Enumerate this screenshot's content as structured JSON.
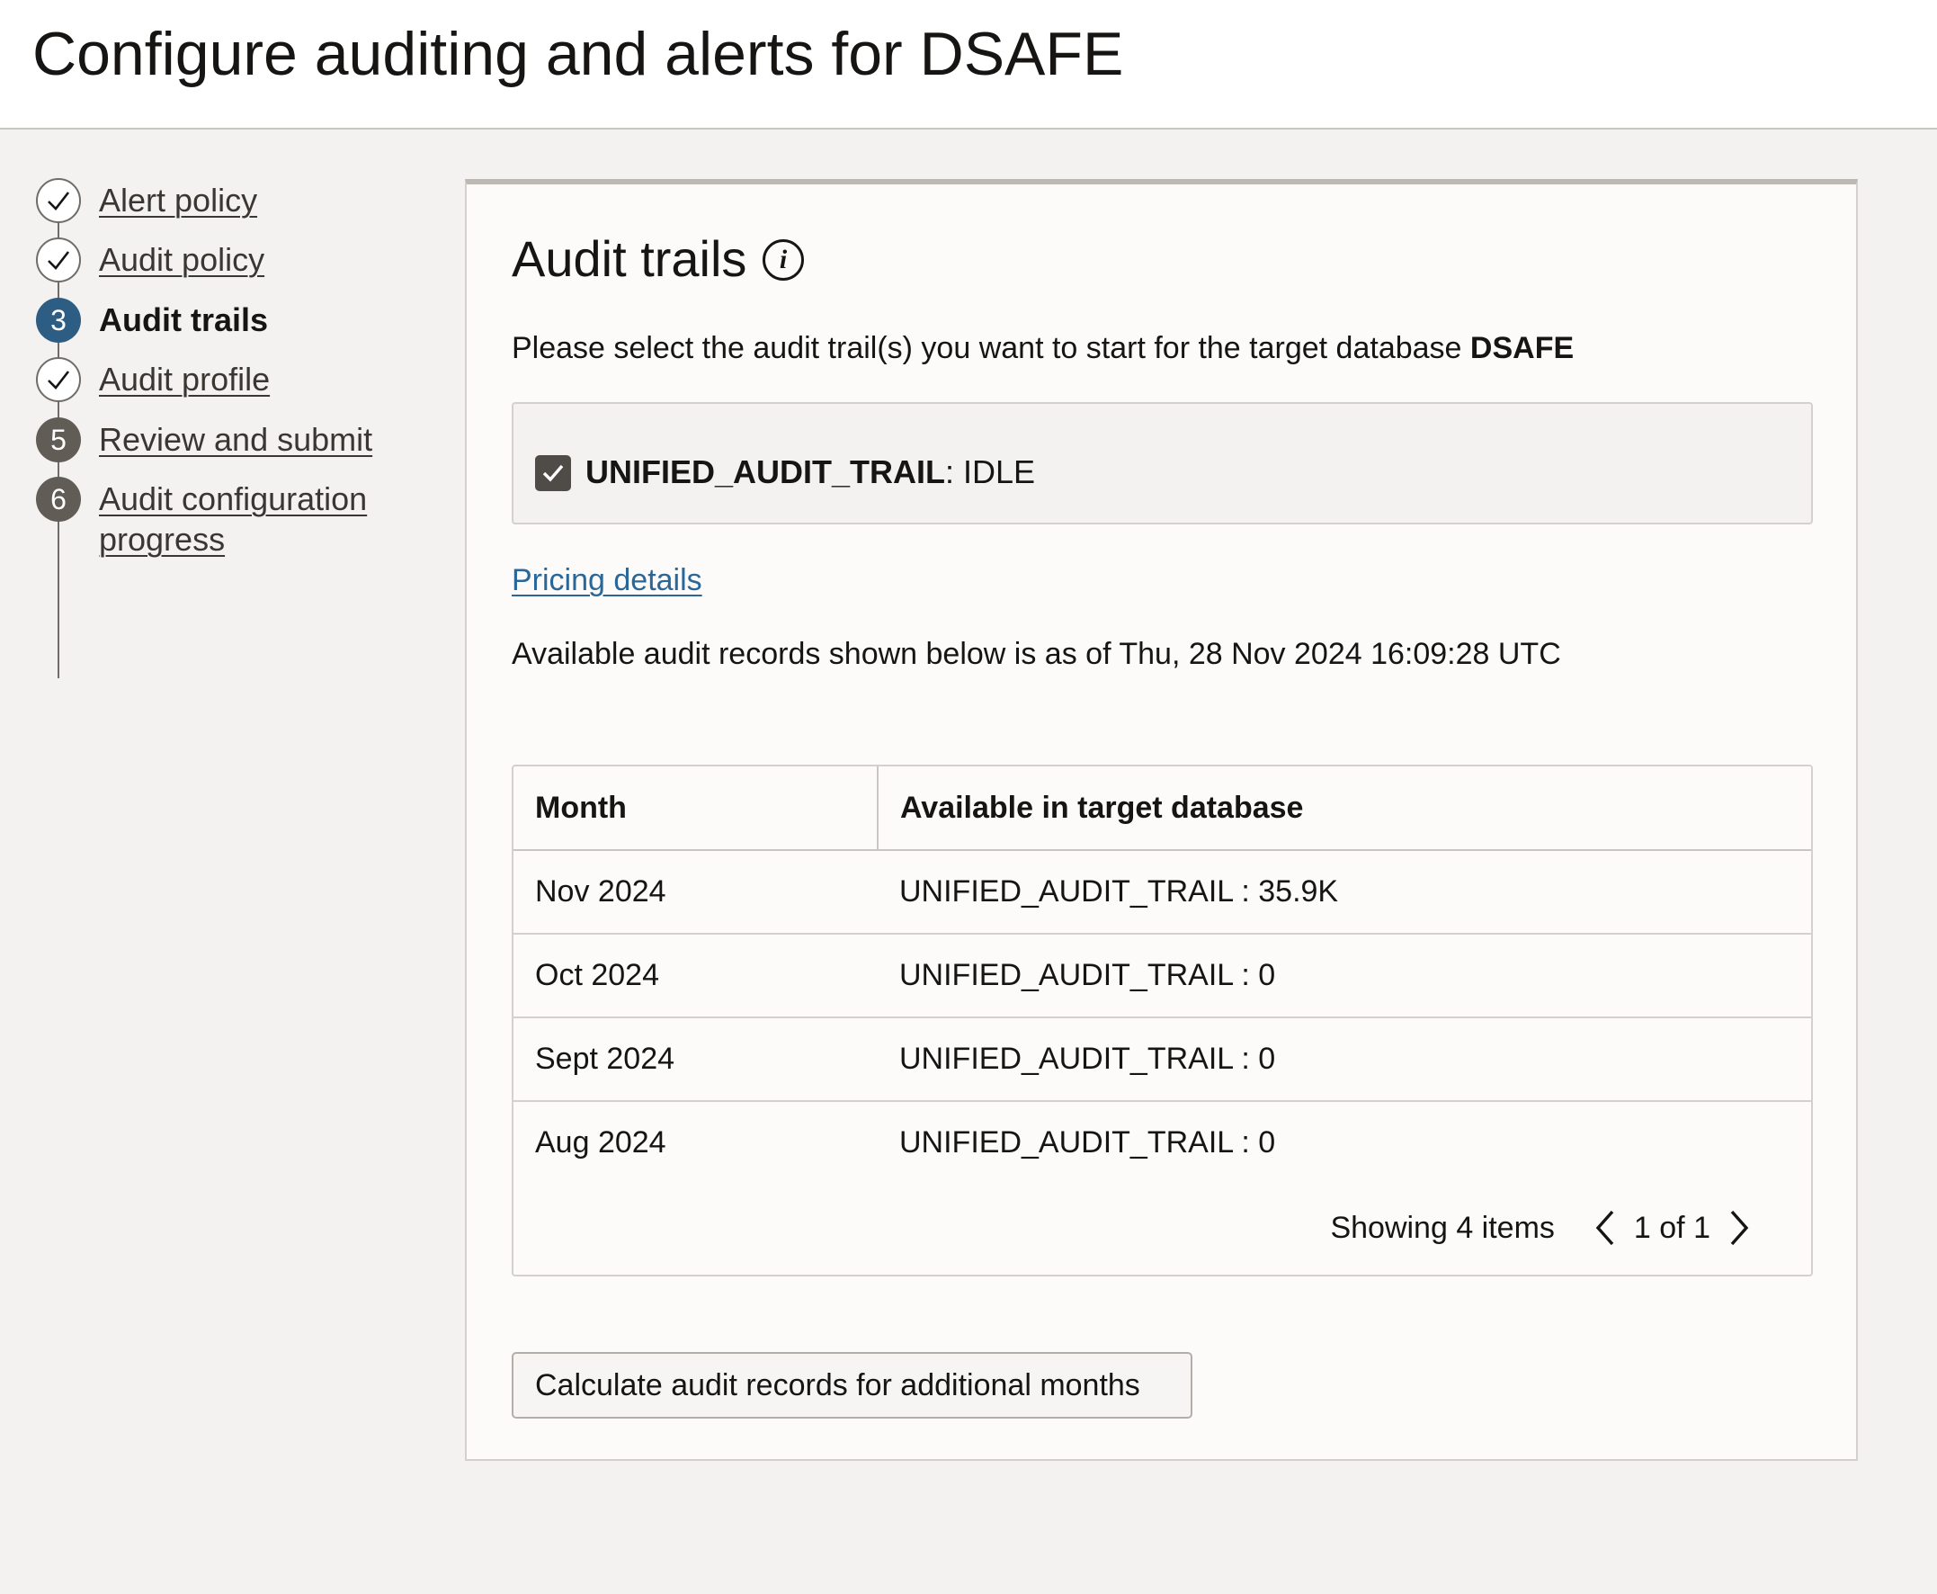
{
  "header": {
    "title": "Configure auditing and alerts for DSAFE"
  },
  "stepper": {
    "steps": [
      {
        "label": "Alert policy",
        "state": "completed"
      },
      {
        "label": "Audit policy",
        "state": "completed"
      },
      {
        "label": "Audit trails",
        "state": "current",
        "number": "3"
      },
      {
        "label": "Audit profile",
        "state": "completed"
      },
      {
        "label": "Review and submit",
        "state": "pending",
        "number": "5"
      },
      {
        "label": "Audit configuration progress",
        "state": "pending",
        "number": "6"
      }
    ]
  },
  "main": {
    "title": "Audit trails",
    "info_icon": "info-icon",
    "instruction_prefix": "Please select the audit trail(s) you want to start for the target database ",
    "instruction_db": "DSAFE",
    "trail": {
      "checked": true,
      "name": "UNIFIED_AUDIT_TRAIL",
      "status_suffix": ": IDLE"
    },
    "pricing_link": "Pricing details",
    "as_of_text": "Available audit records shown below is as of Thu, 28 Nov 2024 16:09:28 UTC",
    "table": {
      "columns": [
        "Month",
        "Available in target database"
      ],
      "rows": [
        {
          "month": "Nov 2024",
          "available": "UNIFIED_AUDIT_TRAIL : 35.9K"
        },
        {
          "month": "Oct 2024",
          "available": "UNIFIED_AUDIT_TRAIL : 0"
        },
        {
          "month": "Sept 2024",
          "available": "UNIFIED_AUDIT_TRAIL : 0"
        },
        {
          "month": "Aug 2024",
          "available": "UNIFIED_AUDIT_TRAIL : 0"
        }
      ]
    },
    "pagination": {
      "showing": "Showing 4 items",
      "page": "1 of 1"
    },
    "calc_button": "Calculate audit records for additional months"
  },
  "colors": {
    "accent": "#2d5d83",
    "link": "#2a6799",
    "background": "#f3f2f1"
  }
}
